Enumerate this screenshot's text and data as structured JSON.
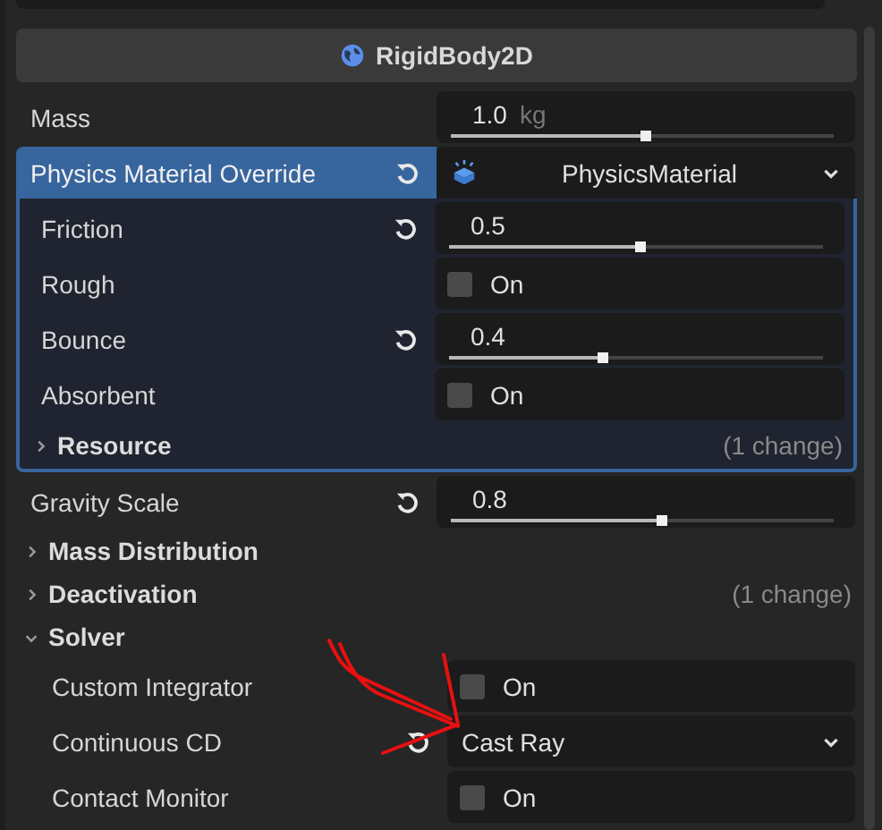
{
  "header": {
    "title": "RigidBody2D"
  },
  "properties": [
    {
      "kind": "slider",
      "label": "Mass",
      "value": "1.0",
      "unit": "kg",
      "level": 0.51,
      "revertable": false
    },
    {
      "kind": "resource",
      "label": "Physics Material Override",
      "value": "PhysicsMaterial",
      "revertable": true,
      "expanded": true,
      "children": [
        {
          "kind": "slider",
          "label": "Friction",
          "value": "0.5",
          "level": 0.51,
          "revertable": true
        },
        {
          "kind": "checkbox",
          "label": "Rough",
          "text": "On",
          "checked": false,
          "revertable": false
        },
        {
          "kind": "slider",
          "label": "Bounce",
          "value": "0.4",
          "level": 0.41,
          "revertable": true
        },
        {
          "kind": "checkbox",
          "label": "Absorbent",
          "text": "On",
          "checked": false,
          "revertable": false
        }
      ],
      "footer": {
        "label": "Resource",
        "note": "(1 change)",
        "expanded": false
      }
    },
    {
      "kind": "slider",
      "label": "Gravity Scale",
      "value": "0.8",
      "level": 0.55,
      "revertable": true
    },
    {
      "kind": "section",
      "label": "Mass Distribution",
      "expanded": false
    },
    {
      "kind": "section",
      "label": "Deactivation",
      "note": "(1 change)",
      "expanded": false
    },
    {
      "kind": "section",
      "label": "Solver",
      "expanded": true,
      "children": [
        {
          "kind": "checkbox",
          "label": "Custom Integrator",
          "text": "On",
          "checked": false,
          "revertable": false
        },
        {
          "kind": "dropdown",
          "label": "Continuous CD",
          "value": "Cast Ray",
          "revertable": true
        },
        {
          "kind": "checkbox",
          "label": "Contact Monitor",
          "text": "On",
          "checked": false,
          "revertable": false
        }
      ]
    }
  ]
}
